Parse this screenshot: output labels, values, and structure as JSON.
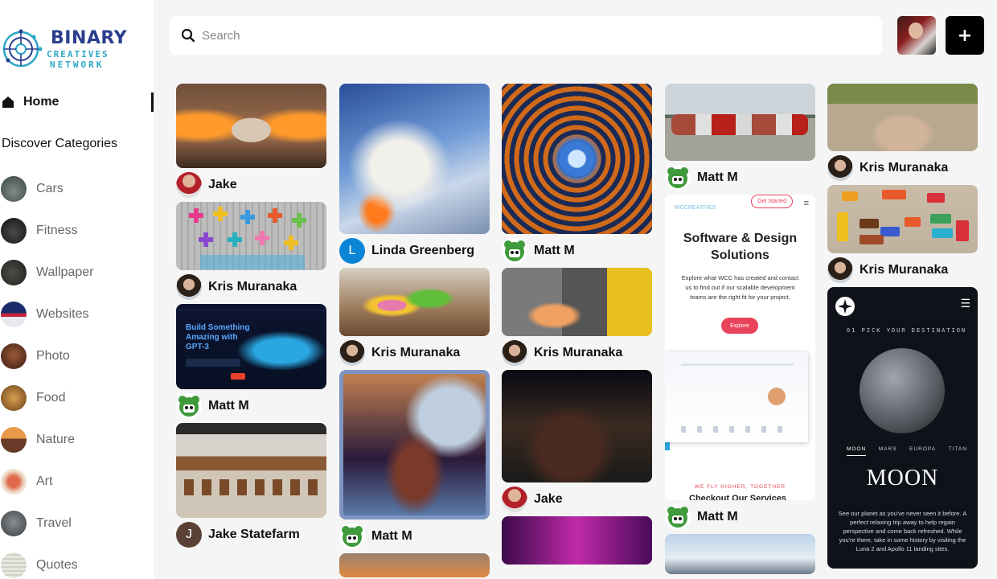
{
  "brand": {
    "line1": "BINARY",
    "line2": "CREATIVES",
    "line3": "NETWORK"
  },
  "nav": {
    "home_label": "Home"
  },
  "categories": {
    "title": "Discover Categories",
    "items": [
      {
        "label": "Cars",
        "color": "#5d6a63"
      },
      {
        "label": "Fitness",
        "color": "#2b2b2b"
      },
      {
        "label": "Wallpaper",
        "color": "#3c3d37"
      },
      {
        "label": "Websites",
        "color": "#2a3a7a"
      },
      {
        "label": "Photo",
        "color": "#6b3a2a"
      },
      {
        "label": "Food",
        "color": "#a8743b"
      },
      {
        "label": "Nature",
        "color": "#b5652f"
      },
      {
        "label": "Art",
        "color": "#d37050"
      },
      {
        "label": "Travel",
        "color": "#666a6d"
      },
      {
        "label": "Quotes",
        "color": "#dcdcd4"
      }
    ]
  },
  "search": {
    "placeholder": "Search",
    "value": ""
  },
  "header": {
    "add_label": "+"
  },
  "pins": {
    "col1": [
      "Jake",
      "Kris Muranaka",
      "Matt M",
      "Jake Statefarm"
    ],
    "col2": [
      "Linda Greenberg",
      "Kris Muranaka",
      "Matt M"
    ],
    "col3": [
      "Matt M",
      "Kris Muranaka",
      "Jake"
    ],
    "col4": [
      "Matt M",
      "Matt M"
    ],
    "col5": [
      "Kris Muranaka",
      "Kris Muranaka"
    ],
    "linda_initial": "L",
    "jake_statefarm_initial": "J"
  },
  "wcc": {
    "logo": "WCCREATIVES",
    "cta": "Get Started",
    "heading": "Software & Design Solutions",
    "body": "Explore what WCC has created and contact us to find out if our scalable development teams are the right fit for your project.",
    "button": "Explore",
    "footer": "WE FLY HIGHER, TOGETHER",
    "footer_heading": "Checkout Our Services"
  },
  "moon": {
    "pick": "01  PICK YOUR DESTINATION",
    "tabs": [
      "MOON",
      "MARS",
      "EUROPA",
      "TITAN"
    ],
    "title": "MOON",
    "desc": "See our planet as you've never seen it before. A perfect relaxing trip away to help regain perspective and come back refreshed. While you're there, take in some history by visiting the Luna 2 and Apollo 11 landing sites."
  },
  "gpt_card": {
    "headline": "Build Something Amazing with GPT-3"
  }
}
